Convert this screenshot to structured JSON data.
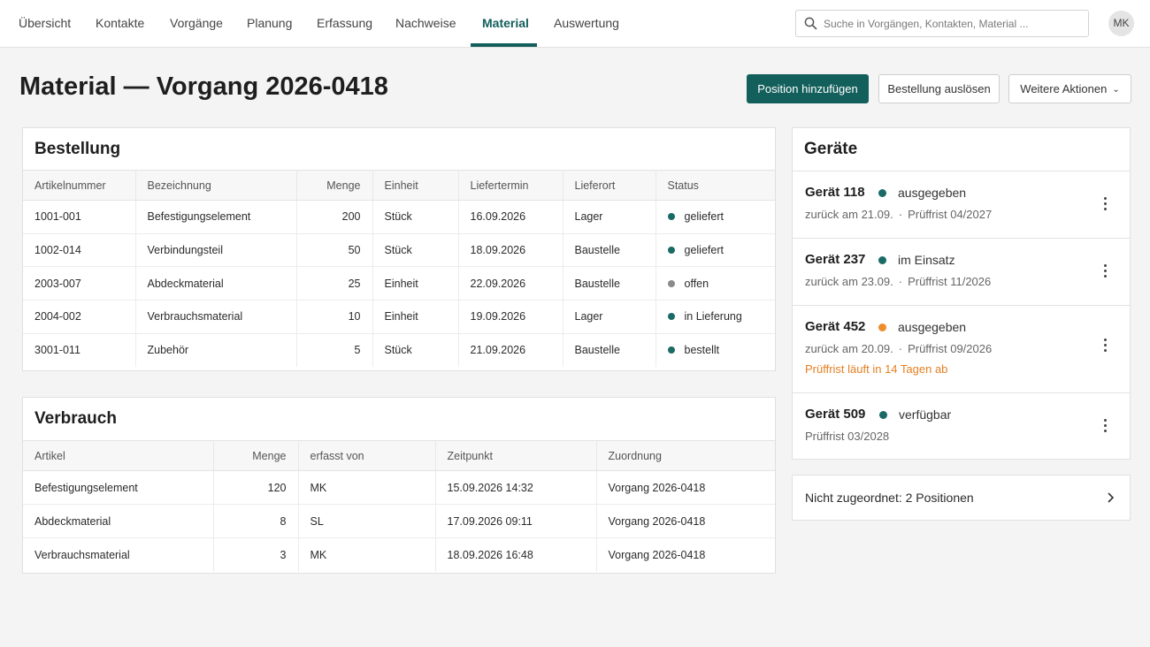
{
  "nav": {
    "tabs": [
      {
        "label": "Übersicht"
      },
      {
        "label": "Kontakte"
      },
      {
        "label": "Vorgänge"
      },
      {
        "label": "Planung"
      },
      {
        "label": "Erfassung"
      },
      {
        "label": "Nachweise"
      },
      {
        "label": "Material"
      },
      {
        "label": "Auswertung"
      }
    ],
    "active_tab": "Material",
    "search_placeholder": "Suche in Vorgängen, Kontakten, Material ...",
    "avatar_initials": "MK"
  },
  "page": {
    "title": "Material — Vorgang 2026-0418",
    "actions": {
      "add_position": "Position hinzufügen",
      "trigger_order": "Bestellung auslösen",
      "more_actions": "Weitere Aktionen"
    }
  },
  "colors": {
    "accent": "#135f5c",
    "status_teal": "#1a6a66",
    "status_grey": "#8a8a8a",
    "status_orange": "#ef8c2b",
    "warning_text": "#e57f22"
  },
  "order": {
    "title": "Bestellung",
    "columns": [
      "Artikelnummer",
      "Bezeichnung",
      "Menge",
      "Einheit",
      "Liefertermin",
      "Lieferort",
      "Status"
    ],
    "rows": [
      {
        "article": "1001-001",
        "name": "Befestigungselement",
        "qty": "200",
        "unit": "Stück",
        "date": "16.09.2026",
        "place": "Lager",
        "status": "geliefert",
        "status_color": "teal"
      },
      {
        "article": "1002-014",
        "name": "Verbindungsteil",
        "qty": "50",
        "unit": "Stück",
        "date": "18.09.2026",
        "place": "Baustelle",
        "status": "geliefert",
        "status_color": "teal"
      },
      {
        "article": "2003-007",
        "name": "Abdeckmaterial",
        "qty": "25",
        "unit": "Einheit",
        "date": "22.09.2026",
        "place": "Baustelle",
        "status": "offen",
        "status_color": "grey"
      },
      {
        "article": "2004-002",
        "name": "Verbrauchsmaterial",
        "qty": "10",
        "unit": "Einheit",
        "date": "19.09.2026",
        "place": "Lager",
        "status": "in Lieferung",
        "status_color": "teal"
      },
      {
        "article": "3001-011",
        "name": "Zubehör",
        "qty": "5",
        "unit": "Stück",
        "date": "21.09.2026",
        "place": "Baustelle",
        "status": "bestellt",
        "status_color": "teal"
      }
    ]
  },
  "consumption": {
    "title": "Verbrauch",
    "columns": [
      "Artikel",
      "Menge",
      "erfasst von",
      "Zeitpunkt",
      "Zuordnung"
    ],
    "rows": [
      {
        "article": "Befestigungselement",
        "qty": "120",
        "by": "MK",
        "time": "15.09.2026 14:32",
        "assignment": "Vorgang 2026-0418"
      },
      {
        "article": "Abdeckmaterial",
        "qty": "8",
        "by": "SL",
        "time": "17.09.2026 09:11",
        "assignment": "Vorgang 2026-0418"
      },
      {
        "article": "Verbrauchsmaterial",
        "qty": "3",
        "by": "MK",
        "time": "18.09.2026 16:48",
        "assignment": "Vorgang 2026-0418"
      }
    ]
  },
  "devices": {
    "title": "Geräte",
    "items": [
      {
        "name": "Gerät 118",
        "status": "ausgegeben",
        "status_color": "teal",
        "return": "zurück am 21.09.",
        "inspection": "Prüffrist 04/2027",
        "warning": ""
      },
      {
        "name": "Gerät 237",
        "status": "im Einsatz",
        "status_color": "teal",
        "return": "zurück am 23.09.",
        "inspection": "Prüffrist 11/2026",
        "warning": ""
      },
      {
        "name": "Gerät 452",
        "status": "ausgegeben",
        "status_color": "orange",
        "return": "zurück am 20.09.",
        "inspection": "Prüffrist 09/2026",
        "warning": "Prüffrist läuft in 14 Tagen ab"
      },
      {
        "name": "Gerät 509",
        "status": "verfügbar",
        "status_color": "teal",
        "return": "",
        "inspection": "Prüffrist 03/2028",
        "warning": ""
      }
    ],
    "meta_separator": "·"
  },
  "unassigned": {
    "label": "Nicht zugeordnet: 2 Positionen"
  }
}
